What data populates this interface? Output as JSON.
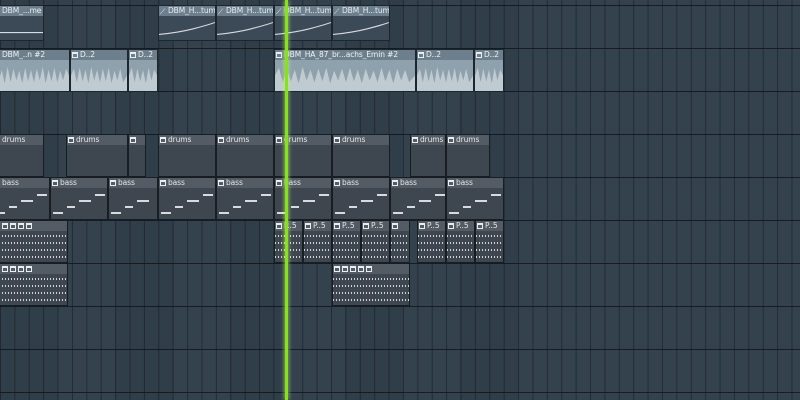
{
  "playlist": {
    "playhead_color": "#8cdc2e",
    "clips": {
      "row1": [
        {
          "name": "DBM_...me"
        },
        {
          "name": "DBM_H...tume"
        },
        {
          "name": "DBM_H...tume"
        },
        {
          "name": "DBM_H...tume"
        },
        {
          "name": "DBM_H...tume"
        }
      ],
      "row2": [
        {
          "name": "DBM_..n #2"
        },
        {
          "name": "D..2"
        },
        {
          "name": "D..2"
        },
        {
          "name": "DBM_HA_87_br...achs_Emin #2"
        },
        {
          "name": "D..2"
        },
        {
          "name": "D..2"
        }
      ],
      "drums_label": "drums",
      "bass_label": "bass",
      "p5_label": "P..5"
    },
    "icons": {
      "auto": "automation-wave-icon",
      "pattern": "pattern-icon"
    }
  }
}
